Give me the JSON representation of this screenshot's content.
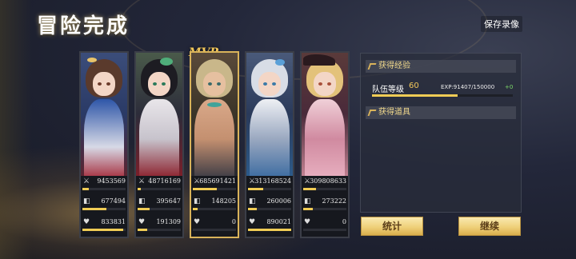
{
  "header": {
    "title": "冒险完成",
    "save_recording": "保存录像",
    "mvp": "MVP"
  },
  "colors": {
    "accent_gold": "#f0cc55",
    "exp_gain_green": "#7ddc6a",
    "mvp_border": "#d9b35a"
  },
  "stat_icons": [
    "sword-icon",
    "shield-icon",
    "heart-icon"
  ],
  "heroes": [
    {
      "damage": "9453569",
      "damage_taken": "677494",
      "healing": "833831",
      "damage_fill": 0.14,
      "taken_fill": 0.55,
      "heal_fill": 0.95,
      "mvp": false
    },
    {
      "damage": "48716169",
      "damage_taken": "395647",
      "healing": "191309",
      "damage_fill": 0.08,
      "taken_fill": 0.28,
      "heal_fill": 0.22,
      "mvp": false
    },
    {
      "damage": "685691421",
      "damage_taken": "148205",
      "healing": "0",
      "damage_fill": 0.55,
      "taken_fill": 0.12,
      "heal_fill": 0.0,
      "mvp": true
    },
    {
      "damage": "313168524",
      "damage_taken": "260006",
      "healing": "890021",
      "damage_fill": 0.35,
      "taken_fill": 0.2,
      "heal_fill": 1.0,
      "mvp": false
    },
    {
      "damage": "309808633",
      "damage_taken": "273222",
      "healing": "0",
      "damage_fill": 0.3,
      "taken_fill": 0.22,
      "heal_fill": 0.0,
      "mvp": false
    }
  ],
  "rewards": {
    "exp_section": "获得经验",
    "team_level_label": "队伍等级",
    "team_level": "60",
    "exp_text": "EXP:91407/150000",
    "exp_gain": "+0",
    "exp_fill": 0.61,
    "items_section": "获得道具"
  },
  "buttons": {
    "stats": "统计",
    "continue": "继续"
  }
}
